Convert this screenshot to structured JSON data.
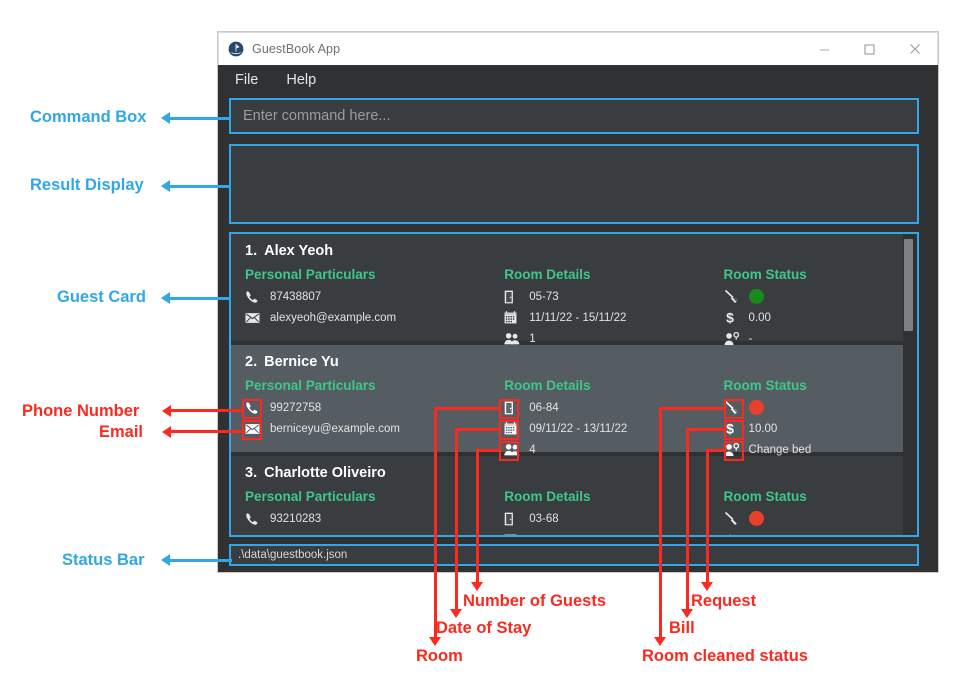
{
  "window": {
    "title": "GuestBook App",
    "icon": "app-logo-icon",
    "controls": {
      "minimize": "—",
      "maximize": "☐",
      "close": "✕"
    }
  },
  "menu": {
    "items": [
      "File",
      "Help"
    ]
  },
  "command_box": {
    "placeholder": "Enter command here...",
    "value": ""
  },
  "result_display": {
    "value": ""
  },
  "status_bar": {
    "path": ".\\data\\guestbook.json"
  },
  "columns": {
    "personal": "Personal Particulars",
    "room": "Room Details",
    "status": "Room Status"
  },
  "guests": [
    {
      "index": "1.",
      "name": "Alex Yeoh",
      "phone": "87438807",
      "email": "alexyeoh@example.com",
      "room": "05-73",
      "dates": "11/11/22 - 15/11/22",
      "guests": "1",
      "cleaned_color": "#1a8a1a",
      "bill": "0.00",
      "request": "-",
      "selected": false
    },
    {
      "index": "2.",
      "name": "Bernice Yu",
      "phone": "99272758",
      "email": "berniceyu@example.com",
      "room": "06-84",
      "dates": "09/11/22 - 13/11/22",
      "guests": "4",
      "cleaned_color": "#e8402a",
      "bill": "10.00",
      "request": "Change bed",
      "selected": true
    },
    {
      "index": "3.",
      "name": "Charlotte Oliveiro",
      "phone": "93210283",
      "email": "",
      "room": "03-68",
      "dates": "",
      "guests": "",
      "cleaned_color": "#e8402a",
      "bill": "",
      "request": "",
      "selected": false
    }
  ],
  "annotations": {
    "blue": [
      {
        "label": "Command Box"
      },
      {
        "label": "Result Display"
      },
      {
        "label": "Guest Card"
      },
      {
        "label": "Status Bar"
      }
    ],
    "red_left": [
      {
        "label": "Phone Number"
      },
      {
        "label": "Email"
      }
    ],
    "red_bottom": [
      {
        "label": "Room"
      },
      {
        "label": "Date of Stay"
      },
      {
        "label": "Number of Guests"
      },
      {
        "label": "Bill"
      },
      {
        "label": "Request"
      },
      {
        "label": "Room cleaned status"
      }
    ]
  },
  "colors": {
    "accent_blue": "#31a6e8",
    "accent_red": "#fb2a20",
    "header_green": "#3dc88a",
    "window_bg": "#2f3133",
    "card_bg": "#3a3d3f",
    "card_selected_bg": "#565d62"
  }
}
